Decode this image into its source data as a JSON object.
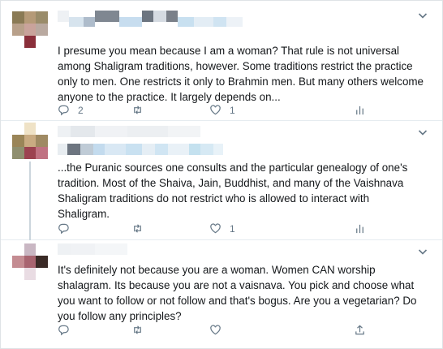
{
  "colors": {
    "icon_gray": "#657786",
    "border": "#e6ecf0",
    "text": "#14171a",
    "thread_line": "#ccd6dd"
  },
  "tweets": [
    {
      "text": "I presume you mean because I am a woman? That rule is not universal\namong Shaligram traditions, however. Some traditions restrict the practice\nonly to men. One restricts it only to Brahmin men. But many others welcome\nanyone to the practice. It largely depends on...",
      "reply_count": "2",
      "retweet_count": "",
      "like_count": "1",
      "icons": [
        "reply-icon",
        "retweet-icon",
        "like-icon",
        "analytics-icon"
      ]
    },
    {
      "text": "...the Puranic sources one consults and the particular genealogy of one's\ntradition. Most of the Shaiva, Jain, Buddhist, and many of the Vaishnava\nShaligram traditions do not restrict who is allowed to interact with\nShaligram.",
      "reply_count": "",
      "retweet_count": "",
      "like_count": "1",
      "icons": [
        "reply-icon",
        "retweet-icon",
        "like-icon",
        "analytics-icon"
      ]
    },
    {
      "text": "It's definitely not because you are a woman.  Women CAN worship\nshalagram.  Its because you are not a vaisnava.  You pick and choose what\nyou want to follow or not follow and that's bogus.  Are you a vegetarian? Do\nyou follow any principles?",
      "reply_count": "",
      "retweet_count": "",
      "like_count": "",
      "icons": [
        "reply-icon",
        "retweet-icon",
        "like-icon",
        "share-icon"
      ]
    }
  ]
}
